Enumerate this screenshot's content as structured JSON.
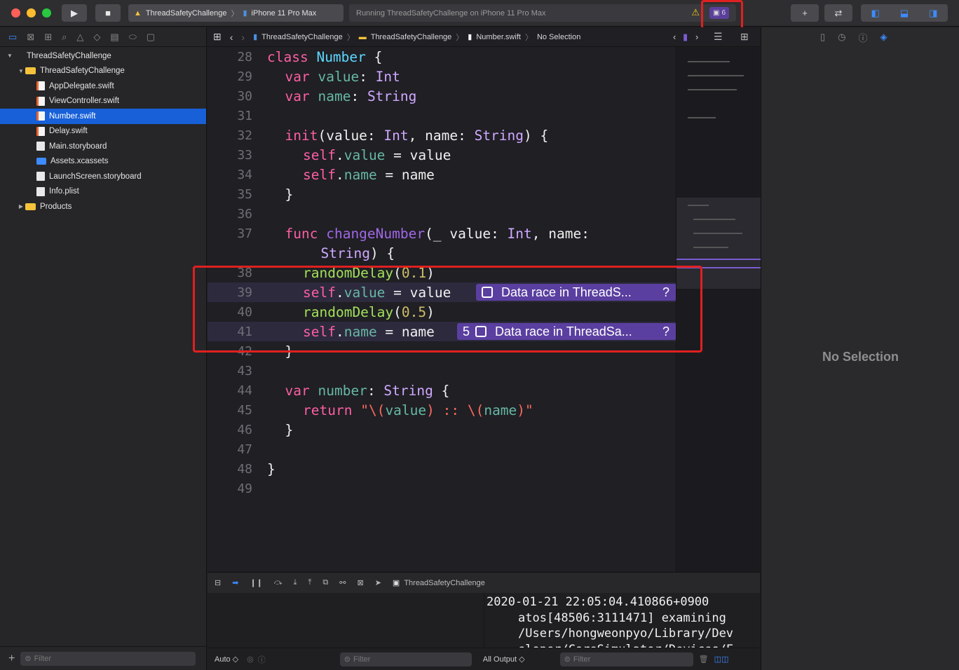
{
  "toolbar": {
    "scheme_name": "ThreadSafetyChallenge",
    "device_name": "iPhone 11 Pro Max",
    "activity_status": "Running ThreadSafetyChallenge on iPhone 11 Pro Max",
    "warning_icon": "warning-triangle-icon",
    "issue_count": "6",
    "colors": {
      "traffic_red": "#fe5f57",
      "traffic_yellow": "#febc2e",
      "traffic_green": "#28c840",
      "runtime_issue": "#5a3fa0",
      "highlight_box": "#e02020"
    }
  },
  "navigator": {
    "items": [
      {
        "label": "ThreadSafetyChallenge",
        "kind": "project",
        "disclosure": "▼",
        "level": 0
      },
      {
        "label": "ThreadSafetyChallenge",
        "kind": "folder",
        "disclosure": "▼",
        "level": 1
      },
      {
        "label": "AppDelegate.swift",
        "kind": "swift",
        "disclosure": "",
        "level": 2
      },
      {
        "label": "ViewController.swift",
        "kind": "swift",
        "disclosure": "",
        "level": 2
      },
      {
        "label": "Number.swift",
        "kind": "swift",
        "disclosure": "",
        "level": 2,
        "selected": true
      },
      {
        "label": "Delay.swift",
        "kind": "swift",
        "disclosure": "",
        "level": 2
      },
      {
        "label": "Main.storyboard",
        "kind": "file",
        "disclosure": "",
        "level": 2
      },
      {
        "label": "Assets.xcassets",
        "kind": "assets",
        "disclosure": "",
        "level": 2
      },
      {
        "label": "LaunchScreen.storyboard",
        "kind": "file",
        "disclosure": "",
        "level": 2
      },
      {
        "label": "Info.plist",
        "kind": "file",
        "disclosure": "",
        "level": 2
      },
      {
        "label": "Products",
        "kind": "folder",
        "disclosure": "▶",
        "level": 1
      }
    ],
    "filter_placeholder": "Filter"
  },
  "jumpbar": {
    "crumbs": [
      "ThreadSafetyChallenge",
      "ThreadSafetyChallenge",
      "Number.swift",
      "No Selection"
    ]
  },
  "editor": {
    "lines": [
      {
        "n": "28",
        "code": "class Number {"
      },
      {
        "n": "29",
        "code": "var value: Int"
      },
      {
        "n": "30",
        "code": "var name: String"
      },
      {
        "n": "31",
        "code": ""
      },
      {
        "n": "32",
        "code": "init(value: Int, name: String) {"
      },
      {
        "n": "33",
        "code": "self.value = value"
      },
      {
        "n": "34",
        "code": "self.name = name"
      },
      {
        "n": "35",
        "code": "}"
      },
      {
        "n": "36",
        "code": ""
      },
      {
        "n": "37",
        "code": "func changeNumber(_ value: Int, name:"
      },
      {
        "n": "",
        "code": "String) {"
      },
      {
        "n": "38",
        "code": "randomDelay(0.1)"
      },
      {
        "n": "39",
        "code": "self.value = value"
      },
      {
        "n": "40",
        "code": "randomDelay(0.5)"
      },
      {
        "n": "41",
        "code": "self.name = name"
      },
      {
        "n": "42",
        "code": "}"
      },
      {
        "n": "43",
        "code": ""
      },
      {
        "n": "44",
        "code": "var number: String {"
      },
      {
        "n": "45",
        "code": "return \"\\(value) :: \\(name)\""
      },
      {
        "n": "46",
        "code": "}"
      },
      {
        "n": "47",
        "code": ""
      },
      {
        "n": "48",
        "code": "}"
      },
      {
        "n": "49",
        "code": ""
      }
    ],
    "issues": [
      {
        "line": "39",
        "count": "",
        "message": "Data race in ThreadS...",
        "help": "?"
      },
      {
        "line": "41",
        "count": "5",
        "message": "Data race in ThreadSa...",
        "help": "?"
      }
    ]
  },
  "debug": {
    "process_name": "ThreadSafetyChallenge",
    "console_lines": [
      "2020-01-21 22:05:04.410866+0900",
      "atos[48506:3111471] examining",
      "/Users/hongweonpyo/Library/Dev",
      "eloper/CoreSimulator/Devices/F"
    ],
    "variables_scope": "Auto ◇",
    "output_scope": "All Output ◇",
    "filter_placeholder": "Filter"
  },
  "inspector": {
    "empty_label": "No Selection"
  }
}
